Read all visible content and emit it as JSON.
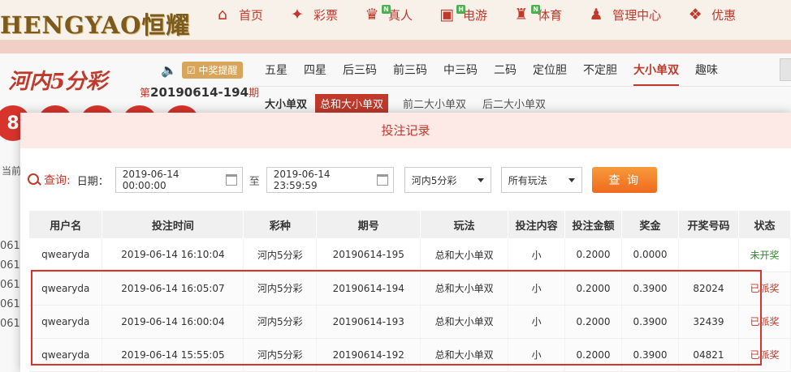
{
  "brand": {
    "logo_text": "HENGYAO恒耀"
  },
  "nav": [
    {
      "label": "首页",
      "icon": "home-icon",
      "glyph": "⌂",
      "badge": ""
    },
    {
      "label": "彩票",
      "icon": "ticket-icon",
      "glyph": "✦",
      "badge": ""
    },
    {
      "label": "真人",
      "icon": "person-icon",
      "glyph": "♛",
      "badge": "N"
    },
    {
      "label": "电游",
      "icon": "gamepad-icon",
      "glyph": "▣",
      "badge": "H"
    },
    {
      "label": "体育",
      "icon": "trophy-icon",
      "glyph": "♜",
      "badge": "N"
    },
    {
      "label": "管理中心",
      "icon": "users-icon",
      "glyph": "♟",
      "badge": ""
    },
    {
      "label": "优惠",
      "icon": "gift-icon",
      "glyph": "❖",
      "badge": ""
    }
  ],
  "game": {
    "logo": "河内5分彩",
    "remind_label": "中奖提醒",
    "issue_prefix": "第",
    "issue_number": "20190614-194",
    "issue_suffix": "期",
    "ball_first": "8",
    "side_label": "当前",
    "side_rows": [
      "061",
      "061",
      "061",
      "061",
      "061"
    ]
  },
  "tabs_main": [
    "五星",
    "四星",
    "后三码",
    "前三码",
    "中三码",
    "二码",
    "定位胆",
    "不定胆",
    "大小单双",
    "趣味"
  ],
  "tabs_main_active": "大小单双",
  "tabs_sub": {
    "title": "大小单双",
    "items": [
      "总和大小单双",
      "前二大小单双",
      "后二大小单双"
    ],
    "active": "总和大小单双"
  },
  "modal": {
    "title": "投注记录",
    "query_label": "查询:",
    "date_label": "日期：",
    "start_date": "2019-06-14 00:00:00",
    "to_label": "至",
    "end_date": "2019-06-14 23:59:59",
    "lottery_select": "河内5分彩",
    "play_select": "所有玩法",
    "query_button": "查 询"
  },
  "table": {
    "headers": [
      "用户名",
      "投注时间",
      "彩种",
      "期号",
      "玩法",
      "投注内容",
      "投注金额",
      "奖金",
      "开奖号码",
      "状态"
    ],
    "rows": [
      [
        "qwearyda",
        "2019-06-14 16:10:04",
        "河内5分彩",
        "20190614-195",
        "总和大小单双",
        "小",
        "0.2000",
        "0.0000",
        "",
        "未开奖"
      ],
      [
        "qwearyda",
        "2019-06-14 16:05:07",
        "河内5分彩",
        "20190614-194",
        "总和大小单双",
        "小",
        "0.2000",
        "0.3900",
        "82024",
        "已派奖"
      ],
      [
        "qwearyda",
        "2019-06-14 16:00:04",
        "河内5分彩",
        "20190614-193",
        "总和大小单双",
        "小",
        "0.2000",
        "0.3900",
        "32439",
        "已派奖"
      ],
      [
        "qwearyda",
        "2019-06-14 15:55:05",
        "河内5分彩",
        "20190614-192",
        "总和大小单双",
        "小",
        "0.2000",
        "0.3900",
        "04821",
        "已派奖"
      ]
    ]
  }
}
